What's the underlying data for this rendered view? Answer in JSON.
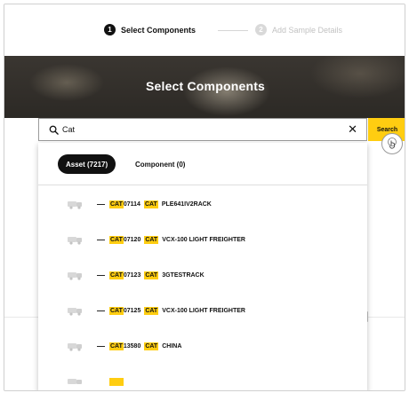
{
  "stepper": {
    "steps": [
      {
        "number": "1",
        "label": "Select Components",
        "active": true
      },
      {
        "number": "2",
        "label": "Add Sample Details",
        "active": false
      }
    ]
  },
  "hero": {
    "title": "Select Components"
  },
  "search": {
    "value": "Cat",
    "placeholder": "",
    "button_label": "Search",
    "clear_glyph": "✕"
  },
  "tabs": [
    {
      "label": "Asset (7217)",
      "active": true
    },
    {
      "label": "Component (0)",
      "active": false
    }
  ],
  "results": [
    {
      "dash": "—",
      "code_hl": "CAT",
      "code_rest": "07114",
      "make": "CAT",
      "model": "PLE641IV2RACK"
    },
    {
      "dash": "—",
      "code_hl": "CAT",
      "code_rest": "07120",
      "make": "CAT",
      "model": "VCX-100 LIGHT FREIGHTER"
    },
    {
      "dash": "—",
      "code_hl": "CAT",
      "code_rest": "07123",
      "make": "CAT",
      "model": "3GTESTRACK"
    },
    {
      "dash": "—",
      "code_hl": "CAT",
      "code_rest": "07125",
      "make": "CAT",
      "model": "VCX-100 LIGHT FREIGHTER"
    },
    {
      "dash": "—",
      "code_hl": "CAT",
      "code_rest": "13580",
      "make": "CAT",
      "model": "CHINA"
    }
  ],
  "colors": {
    "accent_yellow": "#ffcd11",
    "active_tab": "#111111",
    "inactive_step": "#c2c2c2"
  },
  "icons": {
    "search": "search-icon",
    "clear": "close-icon",
    "asset_row": "truck-icon",
    "touch": "touch-pointer-icon"
  }
}
